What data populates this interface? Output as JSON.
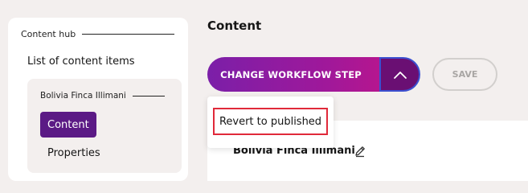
{
  "sidebar": {
    "hub_label": "Content hub",
    "list_link": "List of content items",
    "item": {
      "title": "Bolivia Finca Illimani",
      "tabs": [
        "Content",
        "Properties"
      ],
      "active_tab": "Content"
    }
  },
  "main": {
    "heading": "Content",
    "workflow_button": "CHANGE WORKFLOW STEP",
    "toggle_icon": "chevron-up-icon",
    "save_button": "SAVE",
    "item_name": "Bolivia Finca Illimani",
    "edit_icon": "pencil-icon"
  },
  "dropdown": {
    "options": [
      "Revert to published"
    ],
    "highlighted": "Revert to published"
  },
  "colors": {
    "background": "#f3efee",
    "active_tab": "#5b1a85",
    "workflow_gradient_start": "#7b1fa8",
    "workflow_gradient_end": "#b5168f",
    "toggle_bg": "#6a0f73",
    "toggle_focus": "#3b4fd0",
    "highlight_border": "#e0293a"
  }
}
